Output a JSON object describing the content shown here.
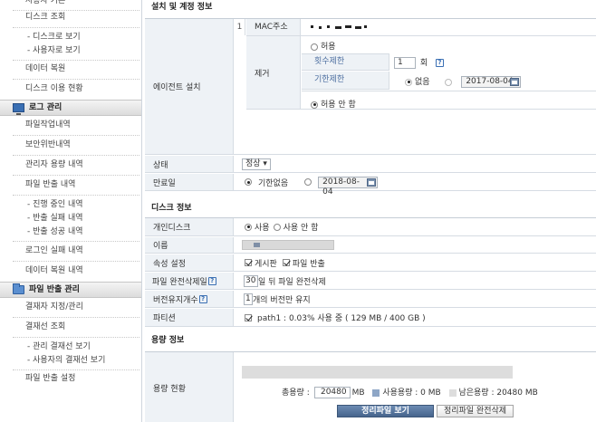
{
  "sidebar": {
    "top_cut": "사용자 기본",
    "items_a": [
      "디스크 조회",
      "- 디스크로 보기",
      "- 사용자로 보기",
      "데이터 복원",
      "디스크 이용 현황"
    ],
    "section_log": "로그 관리",
    "items_b": [
      "파일작업내역",
      "보안위반내역",
      "관리자 용량 내역",
      "파일 반출 내역",
      "- 진행 중인 내역",
      "- 반출 실패 내역",
      "- 반출 성공 내역",
      "로그인 실패 내역",
      "데이터 복원 내역"
    ],
    "section_export": "파일 반출 관리",
    "items_c": [
      "결재자 지정/관리",
      "결재선 조회",
      "- 관리 결재선 보기",
      "- 사용자의 결재선 보기",
      "파일 반출 설정"
    ]
  },
  "install": {
    "section_title": "설치 및 계정 정보",
    "agent_label": "에이전트 설치",
    "index": "1",
    "mac_label": "MAC주소",
    "remove_label": "제거",
    "allow": "허용",
    "count_limit_label": "횟수제한",
    "count_value": "1",
    "count_unit": "회",
    "help_glyph": "?",
    "period_limit_label": "기한제한",
    "period_none": "없음",
    "period_date": "2017-08-04",
    "deny": "허용 안 함",
    "status_label": "상태",
    "status_value": "정상",
    "expire_label": "만료일",
    "expire_none": "기한없음",
    "expire_date": "2018-08-04"
  },
  "disk": {
    "section_title": "디스크 정보",
    "personal_label": "개인디스크",
    "use": "사용",
    "not_use": "사용 안 함",
    "name_label": "이름",
    "attr_label": "속성 설정",
    "board": "게시판",
    "export": "파일 반출",
    "purge_label": "파일 완전삭제일",
    "purge_value": "30",
    "purge_text": "일 뒤 파일 완전삭제",
    "versions_label": "버전유지개수",
    "versions_value": "1",
    "versions_text": "개의 버전만 유지",
    "partition_label": "파티션",
    "partition_text": "path1 : 0.03% 사용 중 ( 129 MB / 400 GB )"
  },
  "capacity": {
    "section_title": "용량 정보",
    "status_label": "용량 현황",
    "total_label": "총용량 :",
    "total_value": "20480",
    "unit": "MB",
    "used_text": "사용용량 : 0 MB",
    "remain_text": "남은용량 : 20480 MB",
    "btn_view": "정리파일 보기",
    "btn_purge": "정리파일 완전삭제",
    "used_color": "#8ea6c6",
    "remain_color": "#dddddd"
  }
}
